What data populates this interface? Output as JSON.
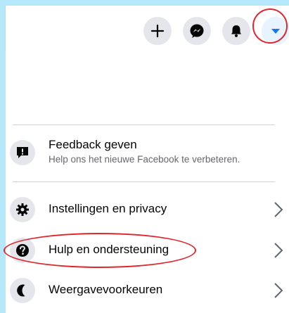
{
  "header": {
    "create_icon": "plus-icon",
    "messenger_icon": "messenger-icon",
    "notifications_icon": "bell-icon",
    "account_icon": "caret-down-icon",
    "accent_color": "#1877f2"
  },
  "menu": {
    "feedback": {
      "title": "Feedback geven",
      "subtitle": "Help ons het nieuwe Facebook te verbeteren.",
      "icon": "feedback-icon"
    },
    "items": [
      {
        "label": "Instellingen en privacy",
        "icon": "gear-icon"
      },
      {
        "label": "Hulp en ondersteuning",
        "icon": "question-icon"
      },
      {
        "label": "Weergavevoorkeuren",
        "icon": "moon-icon"
      }
    ]
  },
  "annotation_color": "#e0262c"
}
